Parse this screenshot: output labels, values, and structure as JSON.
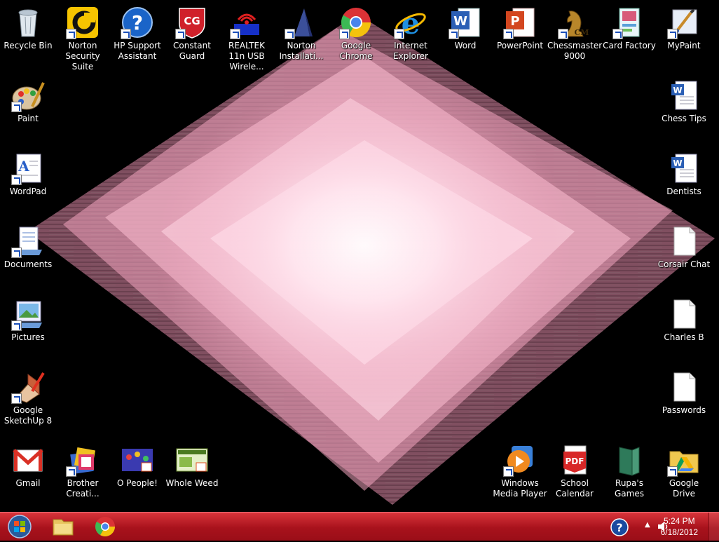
{
  "desktop": {
    "icons": [
      {
        "label": "Recycle Bin",
        "icon": "recycle-bin-icon"
      },
      {
        "label": "Norton Security Suite",
        "icon": "norton-icon"
      },
      {
        "label": "HP Support Assistant",
        "icon": "hp-support-icon"
      },
      {
        "label": "Constant Guard",
        "icon": "constant-guard-icon"
      },
      {
        "label": "REALTEK 11n USB Wirele...",
        "icon": "wireless-icon"
      },
      {
        "label": "Norton Installati...",
        "icon": "norton-install-icon"
      },
      {
        "label": "Google Chrome",
        "icon": "chrome-icon"
      },
      {
        "label": "Internet Explorer",
        "icon": "ie-icon"
      },
      {
        "label": "Word",
        "icon": "word-icon"
      },
      {
        "label": "PowerPoint",
        "icon": "powerpoint-icon"
      },
      {
        "label": "Chessmaster 9000",
        "icon": "chessmaster-icon"
      },
      {
        "label": "Card Factory",
        "icon": "card-factory-icon"
      },
      {
        "label": "MyPaint",
        "icon": "mypaint-icon"
      },
      {
        "label": "Paint",
        "icon": "paint-icon"
      },
      {
        "label": "WordPad",
        "icon": "wordpad-icon"
      },
      {
        "label": "Documents",
        "icon": "documents-icon"
      },
      {
        "label": "Pictures",
        "icon": "pictures-icon"
      },
      {
        "label": "Google SketchUp 8",
        "icon": "sketchup-icon"
      },
      {
        "label": "Gmail",
        "icon": "gmail-icon"
      },
      {
        "label": "Brother Creati...",
        "icon": "brother-icon"
      },
      {
        "label": "O People!",
        "icon": "o-people-icon"
      },
      {
        "label": "Whole Weed",
        "icon": "whole-weed-icon"
      },
      {
        "label": "Windows Media Player",
        "icon": "media-player-icon"
      },
      {
        "label": "School Calendar",
        "icon": "pdf-icon"
      },
      {
        "label": "Rupa's Games",
        "icon": "folder-book-icon"
      },
      {
        "label": "Google Drive",
        "icon": "google-drive-icon"
      },
      {
        "label": "Chess Tips",
        "icon": "word-doc-icon"
      },
      {
        "label": "Dentists",
        "icon": "word-doc-icon"
      },
      {
        "label": "Corsair Chat",
        "icon": "text-file-icon"
      },
      {
        "label": "Charles B",
        "icon": "text-file-icon"
      },
      {
        "label": "Passwords",
        "icon": "text-file-icon"
      }
    ]
  },
  "taskbar": {
    "clock_time": "5:24 PM",
    "clock_date": "6/18/2012",
    "start_icon": "windows-orb-icon",
    "pinned": [
      {
        "name": "file-explorer-icon"
      },
      {
        "name": "chrome-icon"
      }
    ]
  },
  "colors": {
    "taskbar": "#a8121c",
    "wallpaper_pink": "#f4a9c2"
  }
}
